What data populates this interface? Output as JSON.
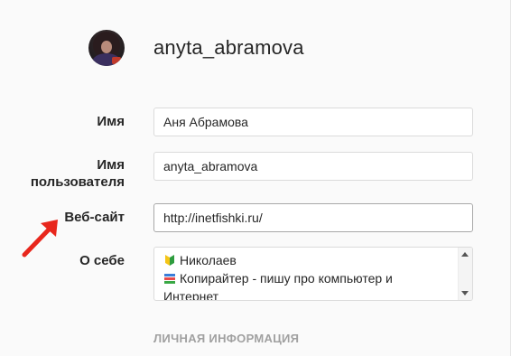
{
  "profile": {
    "username_header": "anyta_abramova"
  },
  "form": {
    "name": {
      "label": "Имя",
      "value": "Аня Абрамова"
    },
    "username": {
      "label": "Имя пользователя",
      "value": "anyta_abramova"
    },
    "website": {
      "label": "Веб-сайт",
      "value": "http://inetfishki.ru/"
    },
    "bio": {
      "label": "О себе",
      "lines": [
        "Николаев",
        "Копирайтер - пишу про компьютер и",
        "Интернет"
      ],
      "line_icons": [
        "beginner-icon",
        "books-icon"
      ]
    }
  },
  "sections": {
    "personal_info": "ЛИЧНАЯ ИНФОРМАЦИЯ"
  },
  "colors": {
    "arrow": "#e8261c",
    "border": "#dbdbdb",
    "section_heading": "#a0a0a0",
    "text": "#262626"
  }
}
